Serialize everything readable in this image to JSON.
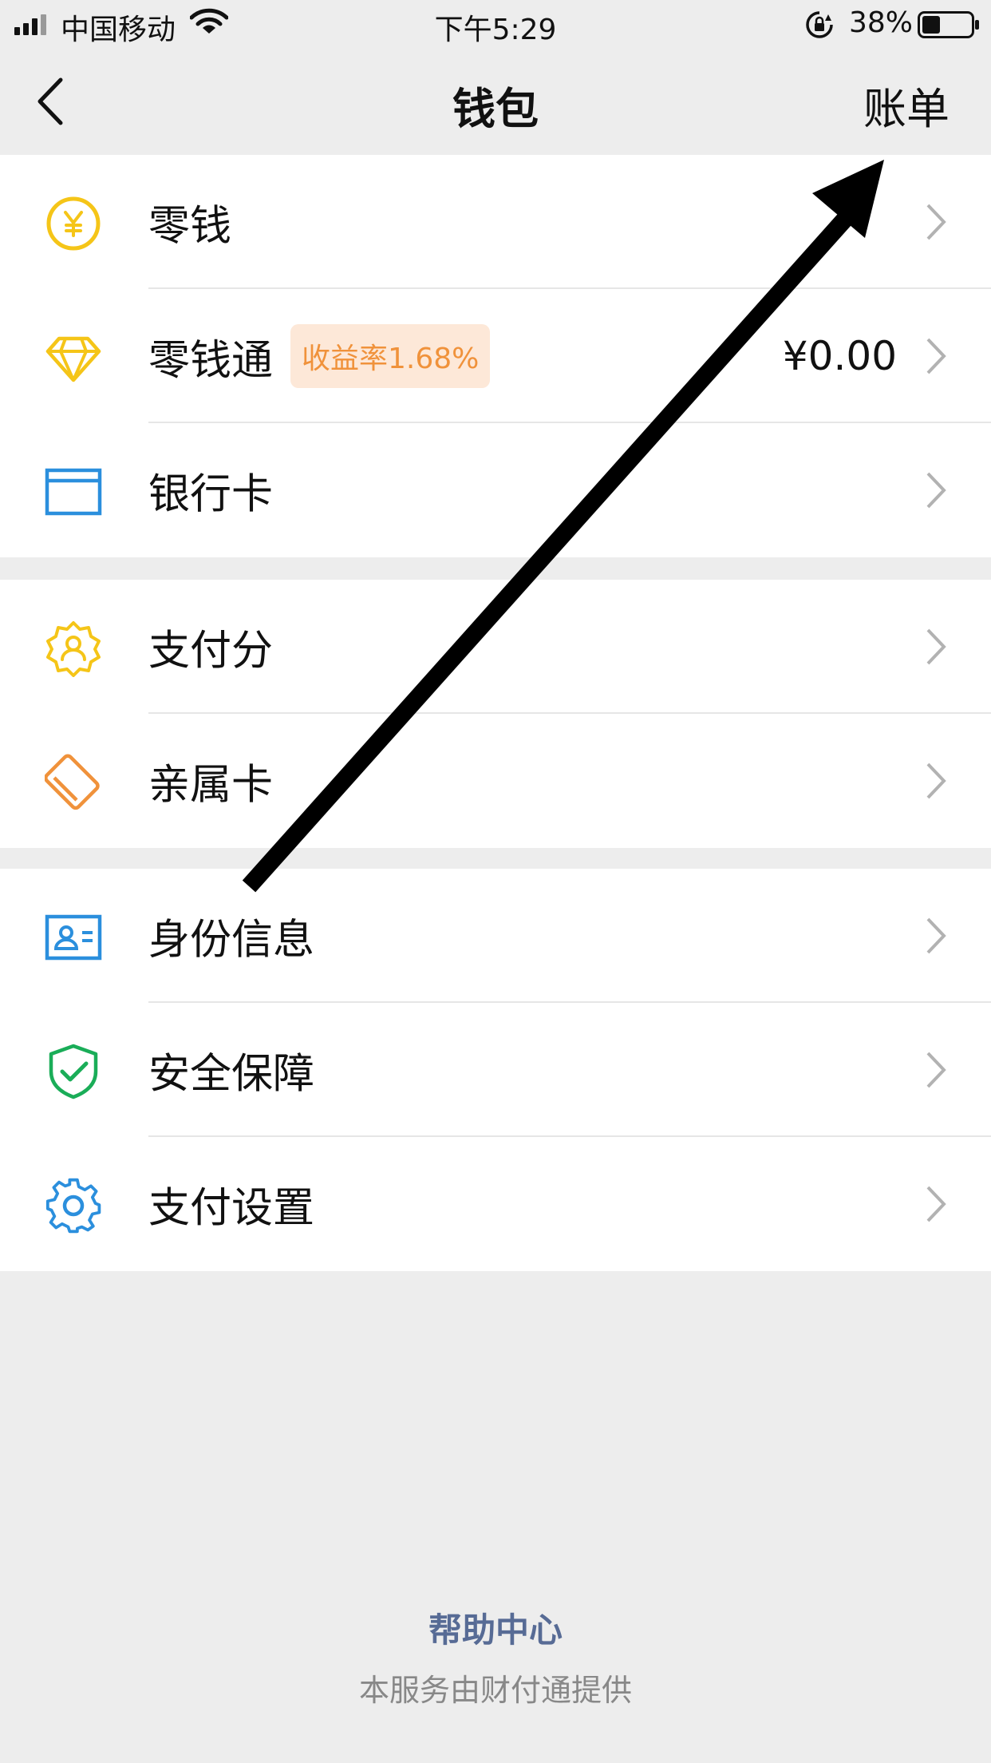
{
  "status_bar": {
    "carrier": "中国移动",
    "time": "下午5:29",
    "battery": "38%"
  },
  "nav": {
    "title": "钱包",
    "right_action": "账单"
  },
  "groups": [
    {
      "items": [
        {
          "label": "零钱",
          "icon": "yuan-coin-icon"
        },
        {
          "label": "零钱通",
          "badge": "收益率1.68%",
          "value": "¥0.00",
          "icon": "diamond-icon"
        },
        {
          "label": "银行卡",
          "icon": "bank-card-icon"
        }
      ]
    },
    {
      "items": [
        {
          "label": "支付分",
          "icon": "pay-score-icon"
        },
        {
          "label": "亲属卡",
          "icon": "family-card-icon"
        }
      ]
    },
    {
      "items": [
        {
          "label": "身份信息",
          "icon": "id-card-icon"
        },
        {
          "label": "安全保障",
          "icon": "shield-check-icon"
        },
        {
          "label": "支付设置",
          "icon": "gear-icon"
        }
      ]
    }
  ],
  "footer": {
    "help": "帮助中心",
    "provider": "本服务由财付通提供"
  },
  "colors": {
    "yellow": "#f5c518",
    "blue": "#2b8fdd",
    "orange": "#f0923b",
    "green": "#1aad58",
    "link": "#576b95"
  }
}
